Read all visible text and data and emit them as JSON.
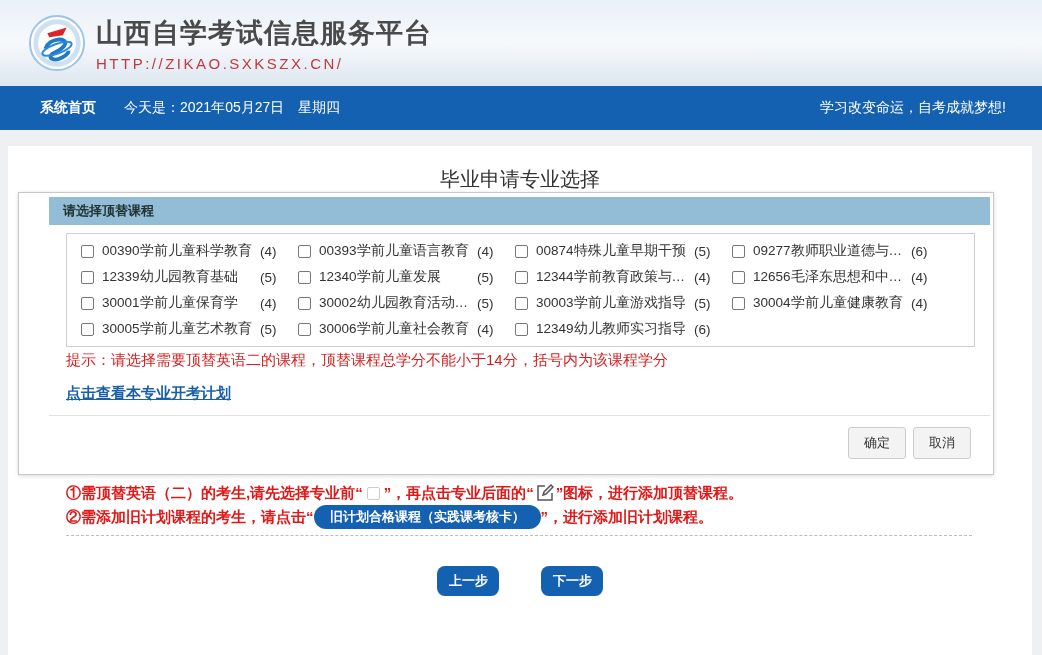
{
  "header": {
    "title": "山西自学考试信息服务平台",
    "url": "HTTP://ZIKAO.SXKSZX.CN/"
  },
  "navbar": {
    "home": "系统首页",
    "date": "今天是：2021年05月27日　星期四",
    "slogan": "学习改变命运，自考成就梦想!"
  },
  "page_title": "毕业申请专业选择",
  "dialog": {
    "title": "请选择顶替课程",
    "courses": [
      {
        "label": "00390学前儿童科学教育",
        "credits": "(4)",
        "checked": false
      },
      {
        "label": "00393学前儿童语言教育",
        "credits": "(4)",
        "checked": false
      },
      {
        "label": "00874特殊儿童早期干预",
        "credits": "(5)",
        "checked": false
      },
      {
        "label": "09277教师职业道德与…",
        "credits": "(6)",
        "checked": false
      },
      {
        "label": "12339幼儿园教育基础",
        "credits": "(5)",
        "checked": false
      },
      {
        "label": "12340学前儿童发展",
        "credits": "(5)",
        "checked": false
      },
      {
        "label": "12344学前教育政策与…",
        "credits": "(4)",
        "checked": false
      },
      {
        "label": "12656毛泽东思想和中…",
        "credits": "(4)",
        "checked": false
      },
      {
        "label": "30001学前儿童保育学",
        "credits": "(4)",
        "checked": false
      },
      {
        "label": "30002幼儿园教育活动…",
        "credits": "(5)",
        "checked": false
      },
      {
        "label": "30003学前儿童游戏指导",
        "credits": "(5)",
        "checked": false
      },
      {
        "label": "30004学前儿童健康教育",
        "credits": "(4)",
        "checked": false
      },
      {
        "label": "30005学前儿童艺术教育",
        "credits": "(5)",
        "checked": false
      },
      {
        "label": "30006学前儿童社会教育",
        "credits": "(4)",
        "checked": false
      },
      {
        "label": "12349幼儿教师实习指导",
        "credits": "(6)",
        "checked": false
      }
    ],
    "hint": "提示：请选择需要顶替英语二的课程，顶替课程总学分不能小于14分，括号内为该课程学分",
    "link": "点击查看本专业开考计划",
    "buttons": [
      "确定",
      "取消"
    ]
  },
  "instructions": [
    [
      {
        "kind": "text",
        "text": "①需顶替英语（二）的考生,请先选择专业前“"
      },
      {
        "kind": "checkbox"
      },
      {
        "kind": "text",
        "text": "”，再点击专业后面的“"
      },
      {
        "kind": "edit_icon"
      },
      {
        "kind": "text",
        "text": "”图标，进行添加顶替课程。"
      }
    ],
    [
      {
        "kind": "text",
        "text": "②需添加旧计划课程的考生，请点击“"
      },
      {
        "kind": "button",
        "text": "旧计划合格课程（实践课考核卡）"
      },
      {
        "kind": "text",
        "text": "”，进行添加旧计划课程。"
      }
    ]
  ],
  "nav_buttons": [
    "上一步",
    "下一步"
  ]
}
